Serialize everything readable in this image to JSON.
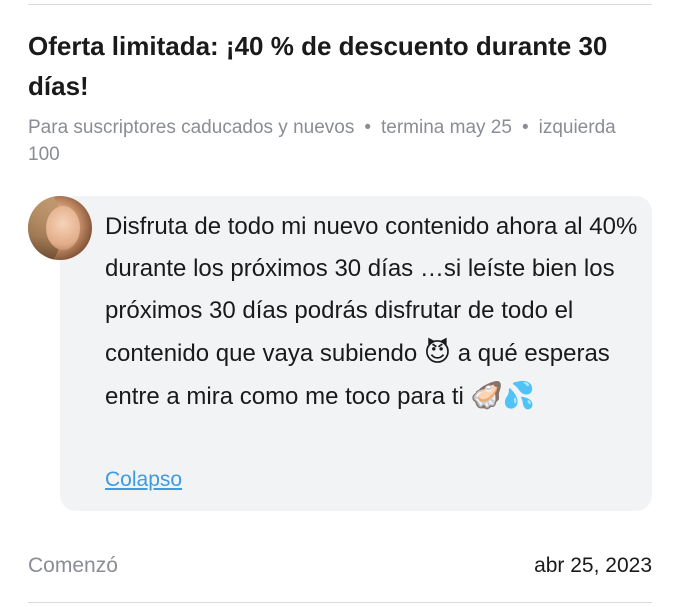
{
  "offer": {
    "title": "Oferta limitada: ¡40 % de descuento durante 30 días!",
    "audience": "Para suscriptores caducados y nuevos",
    "ends": "termina may 25",
    "remaining": "izquierda 100",
    "separator": "•"
  },
  "message": {
    "text_part1": "Disfruta de todo mi nuevo contenido ahora al 40% durante los próximos 30 días …si leíste bien los próximos 30 días podrás disfrutar de todo el contenido que vaya subiendo ",
    "emoji_1": "😈",
    "text_part2": " a qué esperas entre a mira como me toco para ti ",
    "emoji_2": "🦪",
    "emoji_3": "💦",
    "collapse_label": "Colapso"
  },
  "started": {
    "label": "Comenzó",
    "value": "abr 25, 2023"
  },
  "colors": {
    "link": "#3d9be0",
    "muted_text": "#8a8d93",
    "bubble_background": "#f2f3f5"
  },
  "icons": {
    "avatar": "creator-avatar"
  }
}
